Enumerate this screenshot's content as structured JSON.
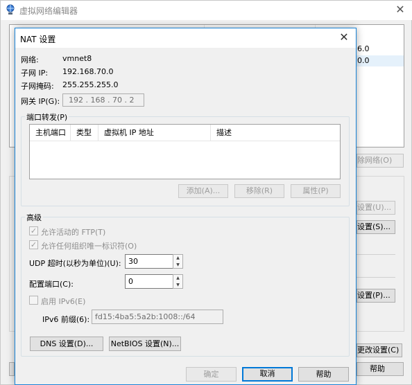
{
  "background_window": {
    "title": "虚拟网络编辑器",
    "table_rows": [
      {
        "value": "6.0"
      },
      {
        "value": "0.0"
      }
    ],
    "buttons": {
      "remove_network": "除网络(O)",
      "nat_settings": "设置(U)...",
      "settings_s": "设置(S)...",
      "settings_p": "设置(P)...",
      "change_settings": "更改设置(C)",
      "help": "帮助"
    }
  },
  "dialog": {
    "title": "NAT 设置",
    "network_label": "网络:",
    "network_value": "vmnet8",
    "subnet_ip_label": "子网 IP:",
    "subnet_ip_value": "192.168.70.0",
    "subnet_mask_label": "子网掩码:",
    "subnet_mask_value": "255.255.255.0",
    "gateway_label": "网关 IP(G):",
    "gateway_value": "192 . 168 . 70 . 2",
    "port_forwarding": {
      "group_title": "端口转发(P)",
      "columns": [
        "主机端口",
        "类型",
        "虚拟机 IP 地址",
        "描述"
      ],
      "add_button": "添加(A)...",
      "remove_button": "移除(R)",
      "properties_button": "属性(P)"
    },
    "advanced": {
      "group_title": "高级",
      "allow_ftp": "允许活动的 FTP(T)",
      "allow_ftp_checked": true,
      "allow_oui": "允许任何组织唯一标识符(O)",
      "allow_oui_checked": true,
      "udp_timeout_label": "UDP 超时(以秒为单位)(U):",
      "udp_timeout_value": "30",
      "config_port_label": "配置端口(C):",
      "config_port_value": "0",
      "enable_ipv6": "启用 IPv6(E)",
      "enable_ipv6_checked": false,
      "ipv6_prefix_label": "IPv6 前缀(6):",
      "ipv6_prefix_value": "fd15:4ba5:5a2b:1008::/64",
      "dns_button": "DNS 设置(D)...",
      "netbios_button": "NetBIOS 设置(N)..."
    },
    "ok_button": "确定",
    "cancel_button": "取消",
    "help_button": "帮助"
  }
}
